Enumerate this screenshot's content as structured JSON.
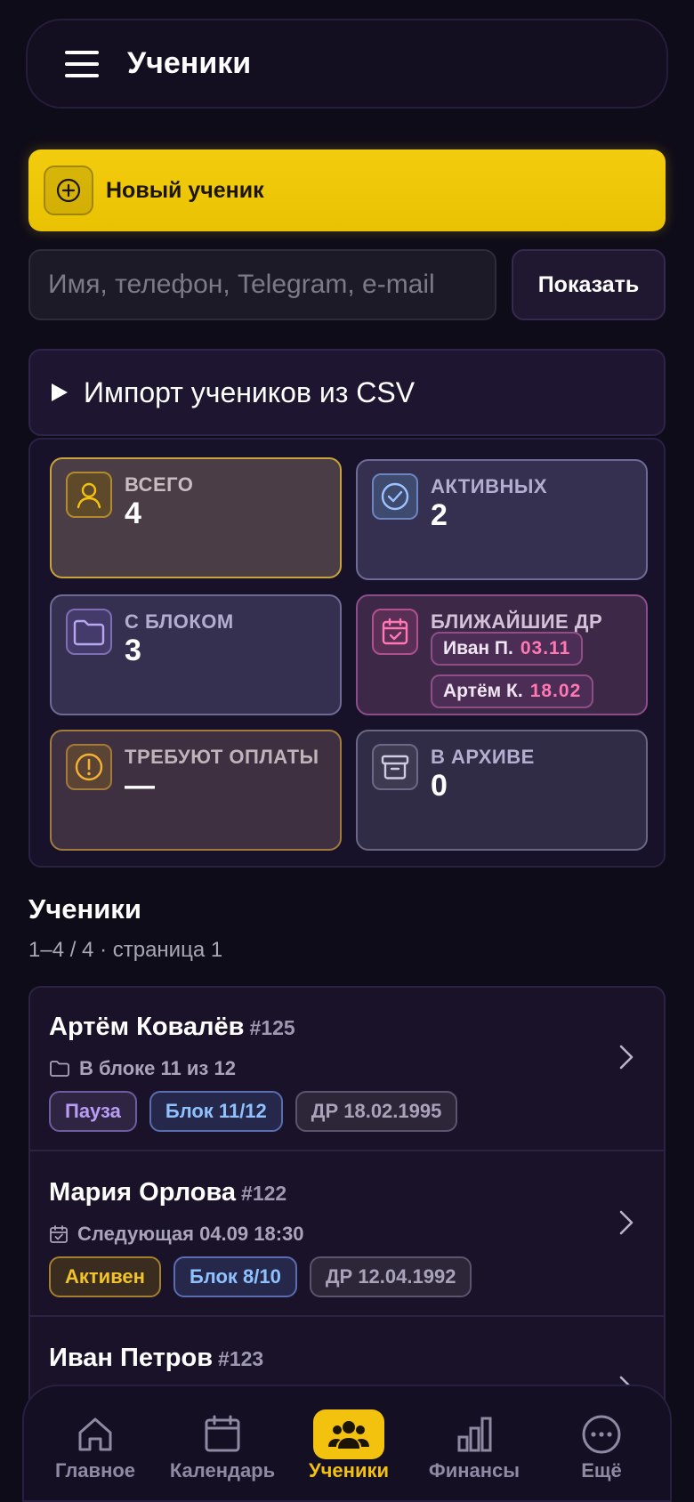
{
  "header": {
    "title": "Ученики",
    "menu_icon": "hamburger-icon"
  },
  "new_student": {
    "label": "Новый ученик",
    "icon": "plus-circle-icon"
  },
  "search": {
    "placeholder": "Имя, телефон, Telegram, e-mail",
    "value": "",
    "button": "Показать"
  },
  "import": {
    "label": "Импорт учеников из CSV",
    "icon": "triangle-right-icon"
  },
  "stats": {
    "total": {
      "label": "ВСЕГО",
      "value": "4",
      "icon": "user-icon"
    },
    "active": {
      "label": "АКТИВНЫХ",
      "value": "2",
      "icon": "check-circle-icon"
    },
    "with_block": {
      "label": "С БЛОКОМ",
      "value": "3",
      "icon": "folder-icon"
    },
    "birthdays": {
      "label": "БЛИЖАЙШИЕ ДР",
      "icon": "calendar-check-icon",
      "items": [
        {
          "name": "Иван П.",
          "date": "03.11"
        },
        {
          "name": "Артём К.",
          "date": "18.02"
        }
      ]
    },
    "need_payment": {
      "label": "ТРЕБУЮТ ОПЛАТЫ",
      "value": "—",
      "icon": "alert-circle-icon"
    },
    "archived": {
      "label": "В АРХИВЕ",
      "value": "0",
      "icon": "archive-icon"
    }
  },
  "list": {
    "title": "Ученики",
    "subtitle": "1–4 / 4 · страница 1",
    "rows": [
      {
        "name": "Артём Ковалёв",
        "id": "#125",
        "meta": "В блоке 11 из 12",
        "meta_icon": "folder-icon",
        "status": "Пауза",
        "block": "Блок 11/12",
        "birthday": "ДР 18.02.1995"
      },
      {
        "name": "Мария Орлова",
        "id": "#122",
        "meta": "Следующая 04.09 18:30",
        "meta_icon": "calendar-icon",
        "status": "Активен",
        "block": "Блок 8/10",
        "birthday": "ДР 12.04.1992"
      },
      {
        "name": "Иван Петров",
        "id": "#123"
      }
    ]
  },
  "nav": {
    "items": [
      {
        "label": "Главное",
        "icon": "home-icon"
      },
      {
        "label": "Календарь",
        "icon": "calendar-icon"
      },
      {
        "label": "Ученики",
        "icon": "users-icon"
      },
      {
        "label": "Финансы",
        "icon": "bar-chart-icon"
      },
      {
        "label": "Ещё",
        "icon": "more-icon"
      }
    ],
    "active": "Ученики"
  },
  "colors": {
    "accent": "#f3c20e",
    "background": "#0f0c19",
    "birthday_date": "#ff77b3"
  }
}
